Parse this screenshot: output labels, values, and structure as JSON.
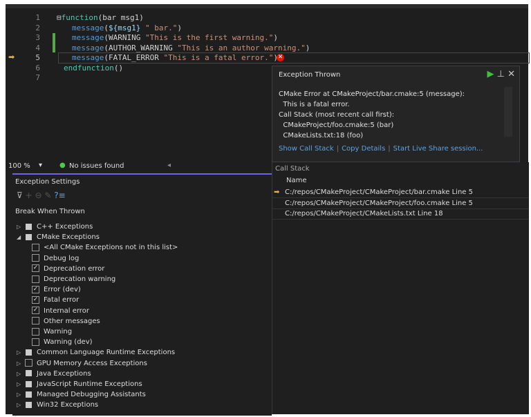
{
  "editor": {
    "lines": [
      {
        "n": "1"
      },
      {
        "n": "2"
      },
      {
        "n": "3"
      },
      {
        "n": "4"
      },
      {
        "n": "5"
      },
      {
        "n": "6"
      },
      {
        "n": "7"
      }
    ],
    "code": {
      "l1a": "function",
      "l1b": "(bar msg1)",
      "msg": "message",
      "l2a": "(",
      "l2b": "${msg1}",
      "l2c": " \" bar.\"",
      "l2d": ")",
      "l3a": "(WARNING ",
      "l3b": "\"This is the first warning.\"",
      "l4a": "(AUTHOR_WARNING ",
      "l4b": "\"This is an author warning.\"",
      "l5a": "(FATAL_ERROR ",
      "l5b": "\"This is a fatal error.\"",
      "close": ")",
      "l6a": "endfunction",
      "l6b": "()"
    }
  },
  "popup": {
    "title": "Exception Thrown",
    "message": "CMake Error at CMakeProject/bar.cmake:5 (message):\n  This is a fatal error.\nCall Stack (most recent call first):\n  CMakeProject/foo.cmake:5 (bar)\n  CMakeLists.txt:18 (foo)",
    "links": [
      "Show Call Stack",
      "Copy Details",
      "Start Live Share session..."
    ]
  },
  "status": {
    "zoom": "100 %",
    "issues": "No issues found"
  },
  "exception_settings": {
    "title": "Exception Settings",
    "column": "Break When Thrown",
    "items": [
      {
        "label": "C++ Exceptions",
        "level": 0,
        "state": "partial",
        "expander": "▷"
      },
      {
        "label": "CMake Exceptions",
        "level": 0,
        "state": "partial",
        "expander": "◢"
      },
      {
        "label": "<All CMake Exceptions not in this list>",
        "level": 1,
        "state": "unchecked"
      },
      {
        "label": "Debug log",
        "level": 1,
        "state": "unchecked"
      },
      {
        "label": "Deprecation error",
        "level": 1,
        "state": "checked"
      },
      {
        "label": "Deprecation warning",
        "level": 1,
        "state": "unchecked"
      },
      {
        "label": "Error (dev)",
        "level": 1,
        "state": "checked"
      },
      {
        "label": "Fatal error",
        "level": 1,
        "state": "checked"
      },
      {
        "label": "Internal error",
        "level": 1,
        "state": "checked"
      },
      {
        "label": "Other messages",
        "level": 1,
        "state": "unchecked"
      },
      {
        "label": "Warning",
        "level": 1,
        "state": "unchecked"
      },
      {
        "label": "Warning (dev)",
        "level": 1,
        "state": "unchecked"
      },
      {
        "label": "Common Language Runtime Exceptions",
        "level": 0,
        "state": "partial",
        "expander": "▷"
      },
      {
        "label": "GPU Memory Access Exceptions",
        "level": 0,
        "state": "unchecked",
        "expander": "▷"
      },
      {
        "label": "Java Exceptions",
        "level": 0,
        "state": "partial",
        "expander": "▷"
      },
      {
        "label": "JavaScript Runtime Exceptions",
        "level": 0,
        "state": "partial",
        "expander": "▷"
      },
      {
        "label": "Managed Debugging Assistants",
        "level": 0,
        "state": "partial",
        "expander": "▷"
      },
      {
        "label": "Win32 Exceptions",
        "level": 0,
        "state": "partial",
        "expander": "▷"
      }
    ]
  },
  "call_stack": {
    "title": "Call Stack",
    "column": "Name",
    "frames": [
      {
        "name": "C:/repos/CMakeProject/CMakeProject/bar.cmake Line 5",
        "current": true
      },
      {
        "name": "C:/repos/CMakeProject/CMakeProject/foo.cmake Line 5",
        "current": false
      },
      {
        "name": "C:/repos/CMakeProject/CMakeLists.txt Line 18",
        "current": false
      }
    ]
  }
}
